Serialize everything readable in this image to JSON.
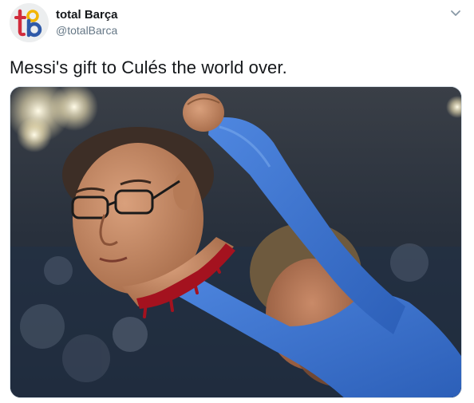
{
  "tweet": {
    "display_name": "total Barça",
    "handle": "@totalBarca",
    "text": "Messi's gift to Culés the world over.",
    "avatar_icon": "total-barca-logo-icon",
    "caret_icon": "chevron-down-icon"
  },
  "colors": {
    "name_text": "#14171a",
    "handle_text": "#657786",
    "jersey_blue": "#3a73d0",
    "logo_red": "#d12c3c",
    "logo_blue": "#2f5aa8",
    "logo_gold": "#f2b500"
  }
}
